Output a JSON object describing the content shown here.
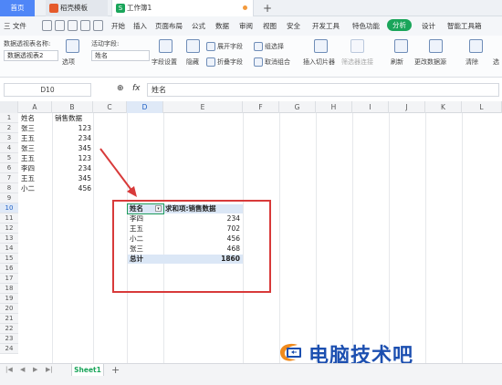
{
  "titlebar": {
    "home_tab": "首页",
    "template_tab": "稻壳模板",
    "workbook_tab": "工作簿1",
    "add_tab": "+"
  },
  "menubar": {
    "file": "三 文件",
    "items": [
      "开始",
      "插入",
      "页面布局",
      "公式",
      "数据",
      "审阅",
      "视图",
      "安全",
      "开发工具",
      "特色功能"
    ],
    "active": "分析",
    "after": [
      "设计",
      "智能工具箱"
    ]
  },
  "ribbon": {
    "pivot_name_label": "数据透视表名称:",
    "pivot_name_value": "数据透视表2",
    "options_label": "选项",
    "active_field_label": "活动字段:",
    "active_field_value": "姓名",
    "field_settings": "字段设置",
    "hide": "隐藏",
    "expand_field": "展开字段",
    "collapse_field": "折叠字段",
    "group_selection": "组选择",
    "ungroup": "取消组合",
    "insert_slicer": "插入切片器",
    "filter_connections": "筛选器连接",
    "refresh": "刷新",
    "change_source": "更改数据源",
    "clear": "清除",
    "select": "选"
  },
  "formula": {
    "name_box": "D10",
    "fx": "fx",
    "value": "姓名"
  },
  "columns": [
    "A",
    "B",
    "C",
    "D",
    "E",
    "F",
    "G",
    "H",
    "I",
    "J",
    "K",
    "L"
  ],
  "selected_column": "D",
  "selected_row": "10",
  "rows": [
    "1",
    "2",
    "3",
    "4",
    "5",
    "6",
    "7",
    "8",
    "9",
    "10",
    "11",
    "12",
    "13",
    "14",
    "15",
    "16",
    "17",
    "18",
    "19",
    "20",
    "21",
    "22",
    "23",
    "24"
  ],
  "source_table": {
    "headers": [
      "姓名",
      "销售数据"
    ],
    "rows": [
      [
        "张三",
        "123"
      ],
      [
        "王五",
        "234"
      ],
      [
        "张三",
        "345"
      ],
      [
        "王五",
        "123"
      ],
      [
        "李四",
        "234"
      ],
      [
        "王五",
        "345"
      ],
      [
        "小二",
        "456"
      ]
    ]
  },
  "pivot": {
    "header_name": "姓名",
    "header_value": "求和项:销售数据",
    "rows": [
      [
        "李四",
        "234"
      ],
      [
        "王五",
        "702"
      ],
      [
        "小二",
        "456"
      ],
      [
        "张三",
        "468"
      ]
    ],
    "total_label": "总计",
    "total_value": "1860"
  },
  "sheets": {
    "active": "Sheet1",
    "add": "+"
  },
  "watermark": "电脑技术吧",
  "colors": {
    "accent_green": "#1aa55a",
    "home_blue": "#4f86f7",
    "highlight_red": "#d83a3a",
    "pivot_header_bg": "#dbe7f6"
  }
}
